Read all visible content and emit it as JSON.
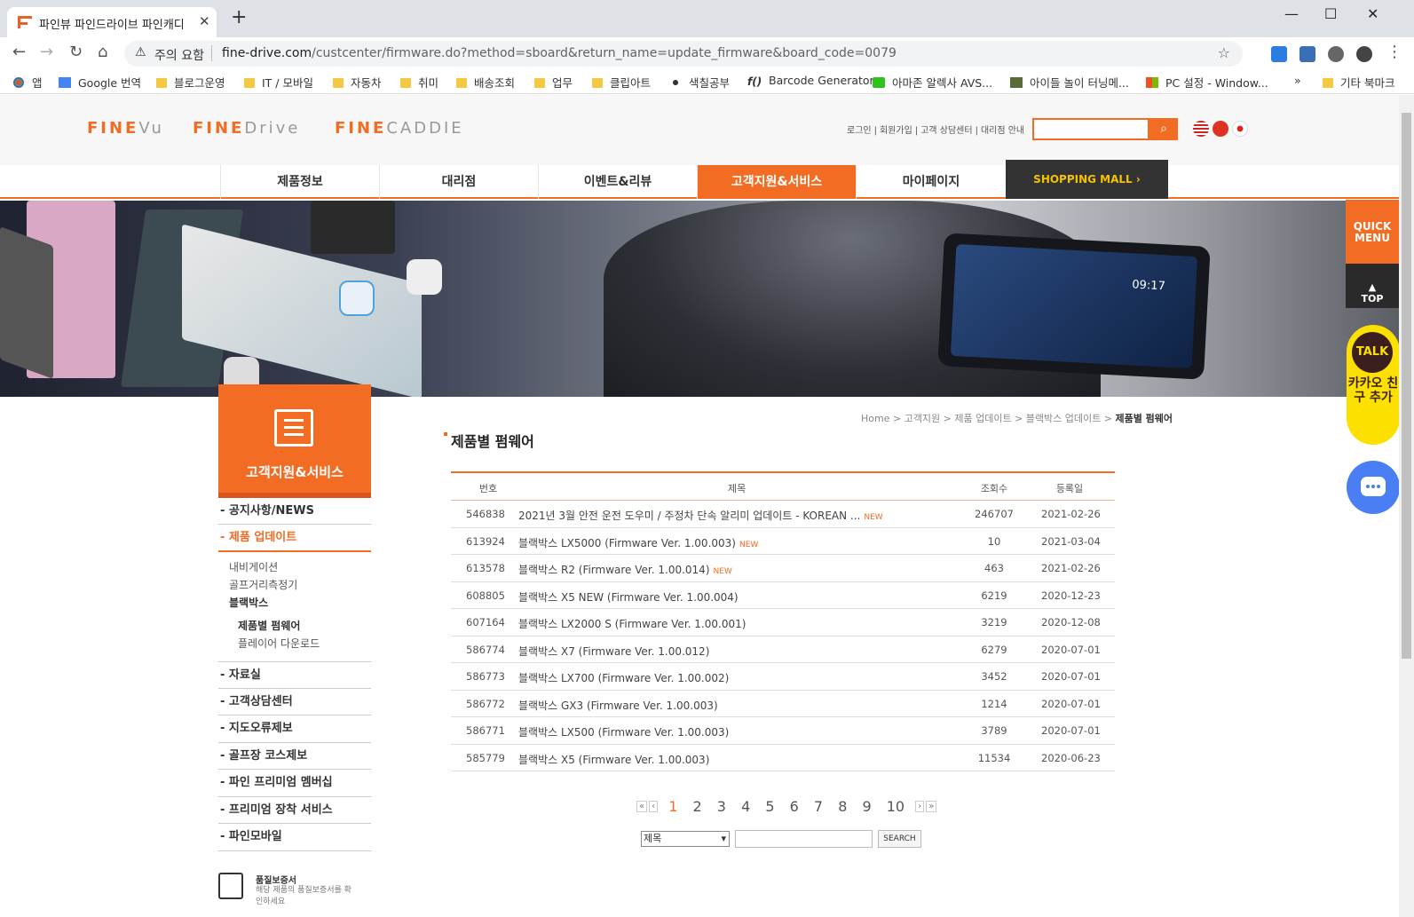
{
  "browser": {
    "tab_title": "파인뷰 파인드라이브 파인캐디",
    "security_label": "주의 요함",
    "url_host": "fine-drive.com",
    "url_path": "/custcenter/firmware.do?method=sboard&return_name=update_firmware&board_code=0079"
  },
  "bookmarks": [
    "앱",
    "Google 번역",
    "블로그운영",
    "IT / 모바일",
    "자동차",
    "취미",
    "배송조회",
    "업무",
    "클립아트",
    "색칠공부",
    "Barcode Generator",
    "아마존 알렉사 AVS...",
    "아이들 놀이 터닝메...",
    "PC 설정 - Window...",
    "기타 북마크"
  ],
  "header": {
    "brands": [
      {
        "o": "FINE",
        "g": "Vu"
      },
      {
        "o": "FINE",
        "g": "Drive"
      },
      {
        "o": "FINE",
        "g": "CADDIE"
      }
    ],
    "toplinks": [
      "로그인",
      "회원가입",
      "고객 상담센터",
      "대리점 안내"
    ]
  },
  "gnb": [
    "제품정보",
    "대리점",
    "이벤트&리뷰",
    "고객지원&서비스",
    "마이페이지"
  ],
  "shopping_mall": "SHOPPING MALL  ›",
  "banner": {
    "clock": "09:17"
  },
  "lnb": {
    "title": "고객지원&서비스",
    "items": [
      "공지사항/NEWS",
      "제품 업데이트",
      "자료실",
      "고객상담센터",
      "지도오류제보",
      "골프장 코스제보",
      "파인 프리미엄 멤버십",
      "프리미엄 장착 서비스",
      "파인모바일"
    ],
    "sub": [
      "내비게이션",
      "골프거리측정기",
      "블랙박스",
      "제품별 펌웨어",
      "플레이어 다운로드"
    ],
    "warranty_title": "품질보증서",
    "warranty_desc": "해당 제품의 품질보증서를 확인하세요"
  },
  "breadcrumb": {
    "path": "Home > 고객지원 > 제품 업데이트 > 블랙박스 업데이트 > ",
    "current": "제품별 펌웨어"
  },
  "page_title": "제품별 펌웨어",
  "board": {
    "headers": [
      "번호",
      "제목",
      "조회수",
      "등록일"
    ],
    "rows": [
      {
        "no": "546838",
        "title": "2021년 3월 안전 운전 도우미 / 주정차 단속 알리미 업데이트 - KOREAN ...",
        "new": "NEW",
        "views": "246707",
        "date": "2021-02-26"
      },
      {
        "no": "613924",
        "title": "블랙박스 LX5000 (Firmware Ver. 1.00.003)",
        "new": "NEW",
        "views": "10",
        "date": "2021-03-04"
      },
      {
        "no": "613578",
        "title": "블랙박스 R2 (Firmware Ver. 1.00.014)",
        "new": "NEW",
        "views": "463",
        "date": "2021-02-26"
      },
      {
        "no": "608805",
        "title": "블랙박스 X5 NEW (Firmware Ver. 1.00.004)",
        "new": "",
        "views": "6219",
        "date": "2020-12-23"
      },
      {
        "no": "607164",
        "title": "블랙박스 LX2000 S (Firmware Ver. 1.00.001)",
        "new": "",
        "views": "3219",
        "date": "2020-12-08"
      },
      {
        "no": "586774",
        "title": "블랙박스 X7 (Firmware Ver. 1.00.012)",
        "new": "",
        "views": "6279",
        "date": "2020-07-01"
      },
      {
        "no": "586773",
        "title": "블랙박스 LX700 (Firmware Ver. 1.00.002)",
        "new": "",
        "views": "3452",
        "date": "2020-07-01"
      },
      {
        "no": "586772",
        "title": "블랙박스 GX3 (Firmware Ver. 1.00.003)",
        "new": "",
        "views": "1214",
        "date": "2020-07-01"
      },
      {
        "no": "586771",
        "title": "블랙박스 LX500 (Firmware Ver. 1.00.003)",
        "new": "",
        "views": "3789",
        "date": "2020-07-01"
      },
      {
        "no": "585779",
        "title": "블랙박스 X5 (Firmware Ver. 1.00.003)",
        "new": "",
        "views": "11534",
        "date": "2020-06-23"
      }
    ]
  },
  "paging": {
    "pages": [
      "1",
      "2",
      "3",
      "4",
      "5",
      "6",
      "7",
      "8",
      "9",
      "10"
    ],
    "current": "1",
    "first": "«",
    "prev": "‹",
    "next": "›",
    "last": "»"
  },
  "search": {
    "select": "제목",
    "button": "SEARCH"
  },
  "quick": {
    "quick": "QUICK MENU",
    "top": "TOP",
    "talk": "TALK",
    "kakao": "카카오 친구 추가"
  },
  "colors": {
    "accent": "#f26c23",
    "dark": "#333333",
    "kakao": "#fce000",
    "chat": "#4a7ef5"
  }
}
